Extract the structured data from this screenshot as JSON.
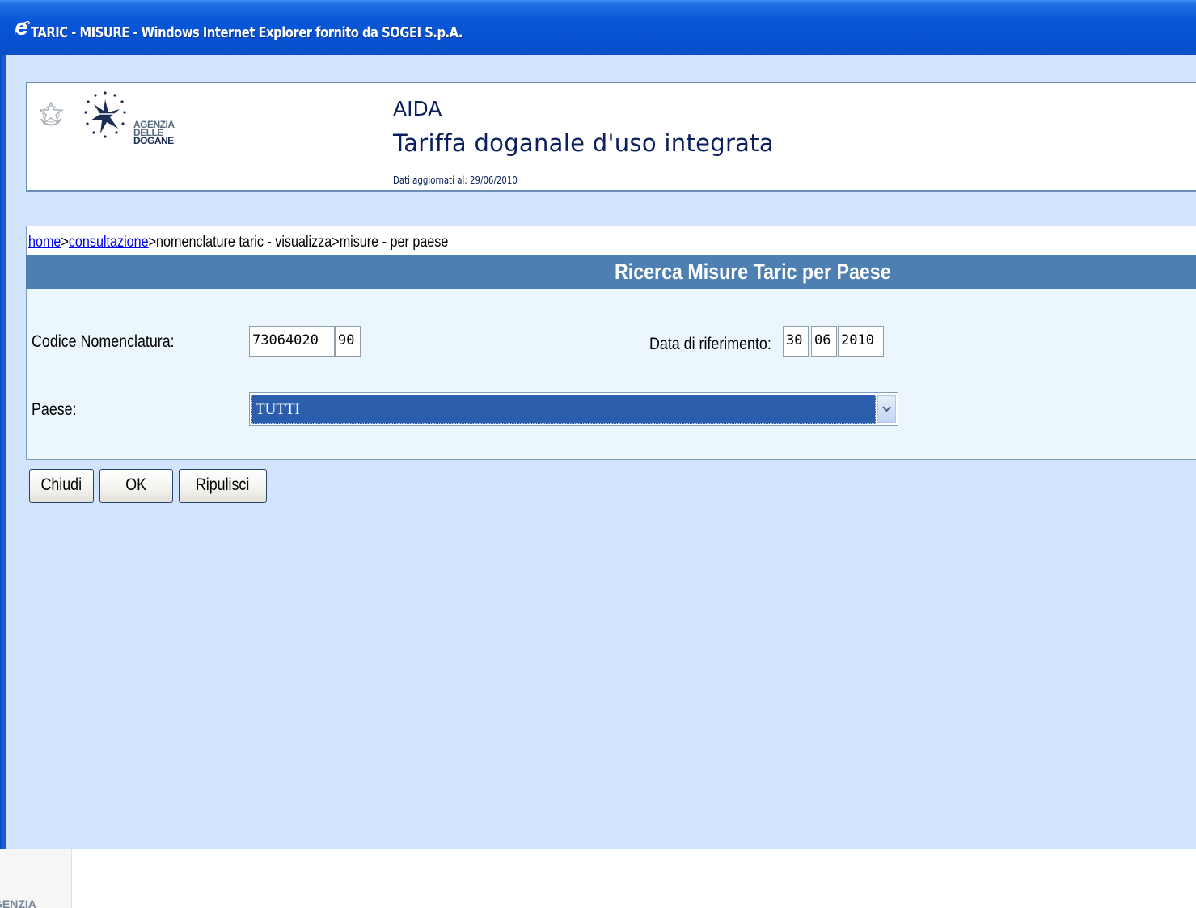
{
  "window": {
    "title": "TARIC - MISURE - Windows Internet Explorer fornito da SOGEI S.p.A."
  },
  "header": {
    "logo_line1": "AGENZIA",
    "logo_line2": "DELLE",
    "logo_line3": "DOGANE",
    "app_name": "AIDA",
    "app_subtitle": "Tariffa doganale d'uso integrata",
    "updated": "Dati aggiornati al: 29/06/2010"
  },
  "breadcrumb": {
    "home": "home",
    "sep1": ">",
    "consultazione": "consultazione",
    "rest": ">nomenclature taric - visualizza>misure - per paese"
  },
  "section": {
    "title": "Ricerca Misure Taric per Paese"
  },
  "form": {
    "codice_label": "Codice Nomenclatura:",
    "codice_value": "73064020",
    "codice_suffix": "90",
    "data_label": "Data di riferimento:",
    "data_day": "30",
    "data_month": "06",
    "data_year": "2010",
    "paese_label": "Paese:",
    "paese_value": "TUTTI"
  },
  "buttons": {
    "chiudi": "Chiudi",
    "ok": "OK",
    "ripulisci": "Ripulisci"
  },
  "bottom": {
    "thumb_text": "GENZIA"
  },
  "colors": {
    "title_bar": "#0551d2",
    "section_header": "#4d7fb3",
    "page_background": "#d1e4fb",
    "form_background": "#ebf7fc",
    "selected_option": "#2b5fad"
  }
}
